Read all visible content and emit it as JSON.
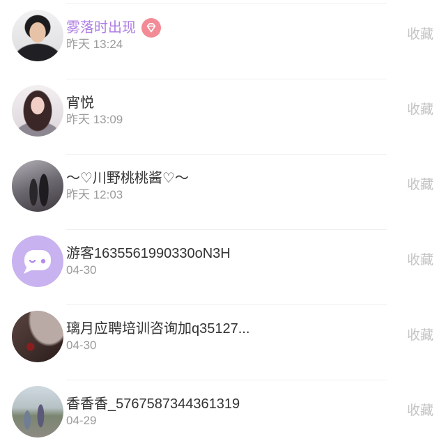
{
  "list": {
    "items": [
      {
        "name": "雾落时出现",
        "time": "昨天 13:24",
        "action": "收藏",
        "avatar_icon": "user-photo",
        "badge_icon": "diamond-badge-icon"
      },
      {
        "name": "宵悦",
        "time": "昨天 13:09",
        "action": "收藏",
        "avatar_icon": "user-photo"
      },
      {
        "name": "～♡川野桃桃酱♡～",
        "time": "昨天 12:03",
        "action": "收藏",
        "avatar_icon": "user-photo"
      },
      {
        "name": "游客1635561990330oN3H",
        "time": "04-30",
        "action": "收藏",
        "avatar_icon": "guest-chat-bubble-icon"
      },
      {
        "name": "璃月应聘培训咨询加q35127...",
        "time": "04-30",
        "action": "收藏",
        "avatar_icon": "user-photo"
      },
      {
        "name": "香香香_5767587344361319",
        "time": "04-29",
        "action": "收藏",
        "avatar_icon": "user-photo"
      }
    ]
  },
  "colors": {
    "highlight_name": "#b07ee3",
    "badge": "#f38b97",
    "guest_avatar": "#c8b2f0",
    "name": "#333333",
    "time": "#9b9b9b",
    "action": "#c3c3c3"
  }
}
